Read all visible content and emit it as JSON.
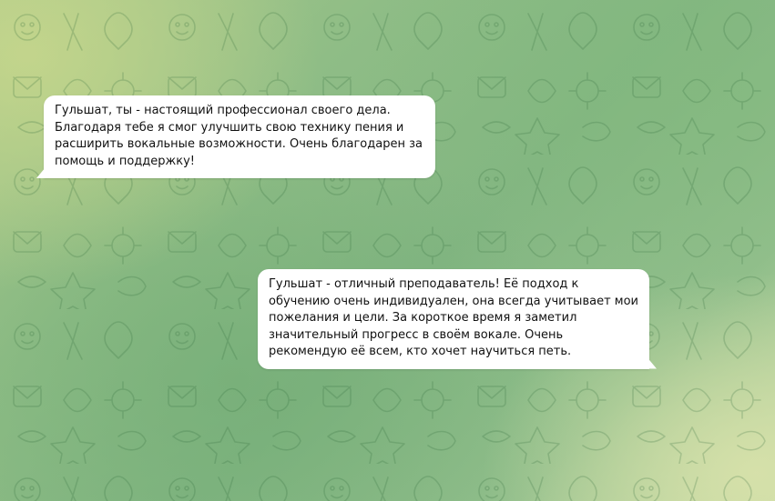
{
  "messages": [
    {
      "direction": "incoming",
      "text": "Гульшат, ты - настоящий профессионал своего дела. Благодаря тебе я смог улучшить свою технику пения и расширить вокальные возможности. Очень благодарен за помощь и поддержку!"
    },
    {
      "direction": "outgoing",
      "text": "Гульшат - отличный преподаватель! Её подход к обучению очень индивидуален, она всегда учитывает мои пожелания и цели. За короткое время я заметил значительный прогресс в своём вокале. Очень рекомендую её всем, кто хочет научиться петь."
    }
  ],
  "colors": {
    "bubble": "#ffffff",
    "text": "#111111",
    "background_main": "#8fbd86",
    "background_light": "#c4d9a4",
    "pattern_line": "#4f8a55"
  }
}
